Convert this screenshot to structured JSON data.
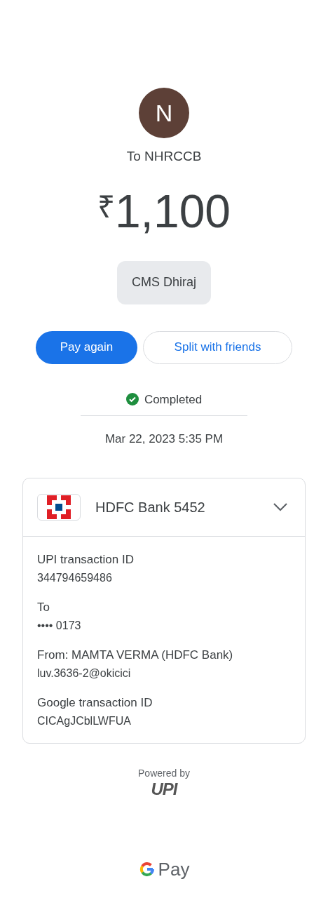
{
  "avatar": {
    "initial": "N"
  },
  "recipient": "To NHRCCB",
  "amount": {
    "currency": "₹",
    "value": "1,100"
  },
  "note": "CMS Dhiraj",
  "buttons": [
    {
      "label": "Pay again",
      "kind": "primary"
    },
    {
      "label": "Split with friends",
      "kind": "outline"
    }
  ],
  "status": {
    "label": "Completed",
    "completed": true
  },
  "date": "Mar 22, 2023 5:35 PM",
  "account": {
    "name": "HDFC Bank 5452",
    "expanded": true,
    "details": [
      {
        "label": "UPI transaction ID",
        "value": "344794659486"
      },
      {
        "label": "To",
        "value": "•••• 0173"
      },
      {
        "label": "From: MAMTA VERMA (HDFC Bank)",
        "value": "luv.3636-2@okicici"
      },
      {
        "label": "Google transaction ID",
        "value": "CICAgJCblLWFUA"
      }
    ]
  },
  "footer": {
    "powered_by": "Powered by",
    "upi": "UPI",
    "brand": "Pay"
  }
}
